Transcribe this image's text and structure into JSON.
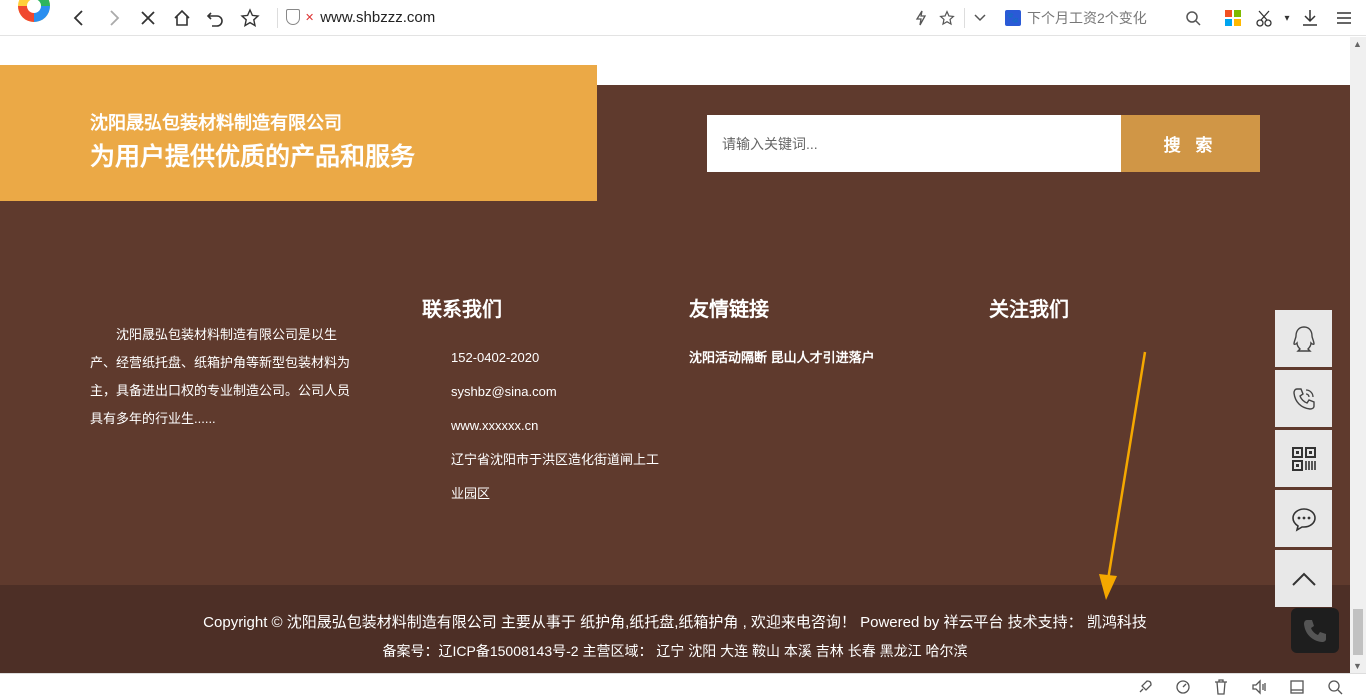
{
  "browser": {
    "url": "www.shbzzz.com",
    "news_text": "下个月工资2个变化"
  },
  "hero": {
    "company": "沈阳晟弘包装材料制造有限公司",
    "slogan": "为用户提供优质的产品和服务",
    "search_placeholder": "请输入关键词...",
    "search_button": "搜 索"
  },
  "about": {
    "text": "沈阳晟弘包装材料制造有限公司是以生产、经营纸托盘、纸箱护角等新型包装材料为主，具备进出口权的专业制造公司。公司人员具有多年的行业生......"
  },
  "contact": {
    "title": "联系我们",
    "phone": "152-0402-2020",
    "email": "syshbz@sina.com",
    "website": "www.xxxxxx.cn",
    "address": "辽宁省沈阳市于洪区造化街道闸上工业园区"
  },
  "links": {
    "title": "友情链接",
    "items": [
      "沈阳活动隔断",
      "昆山人才引进落户"
    ]
  },
  "follow": {
    "title": "关注我们"
  },
  "footer": {
    "copyright": "Copyright © 沈阳晟弘包装材料制造有限公司 主要从事于 纸护角,纸托盘,纸箱护角 , 欢迎来电咨询！ Powered by 祥云平台   技术支持： 凯鸿科技",
    "icp": "备案号：辽ICP备15008143号-2 主营区域： 辽宁 沈阳 大连 鞍山 本溪 吉林 长春 黑龙江 哈尔滨"
  },
  "colors": {
    "brown": "#5f3a2d",
    "dark_brown": "#4d2f26",
    "orange": "#eba946",
    "gold": "#d09646",
    "arrow": "#f5a800"
  }
}
